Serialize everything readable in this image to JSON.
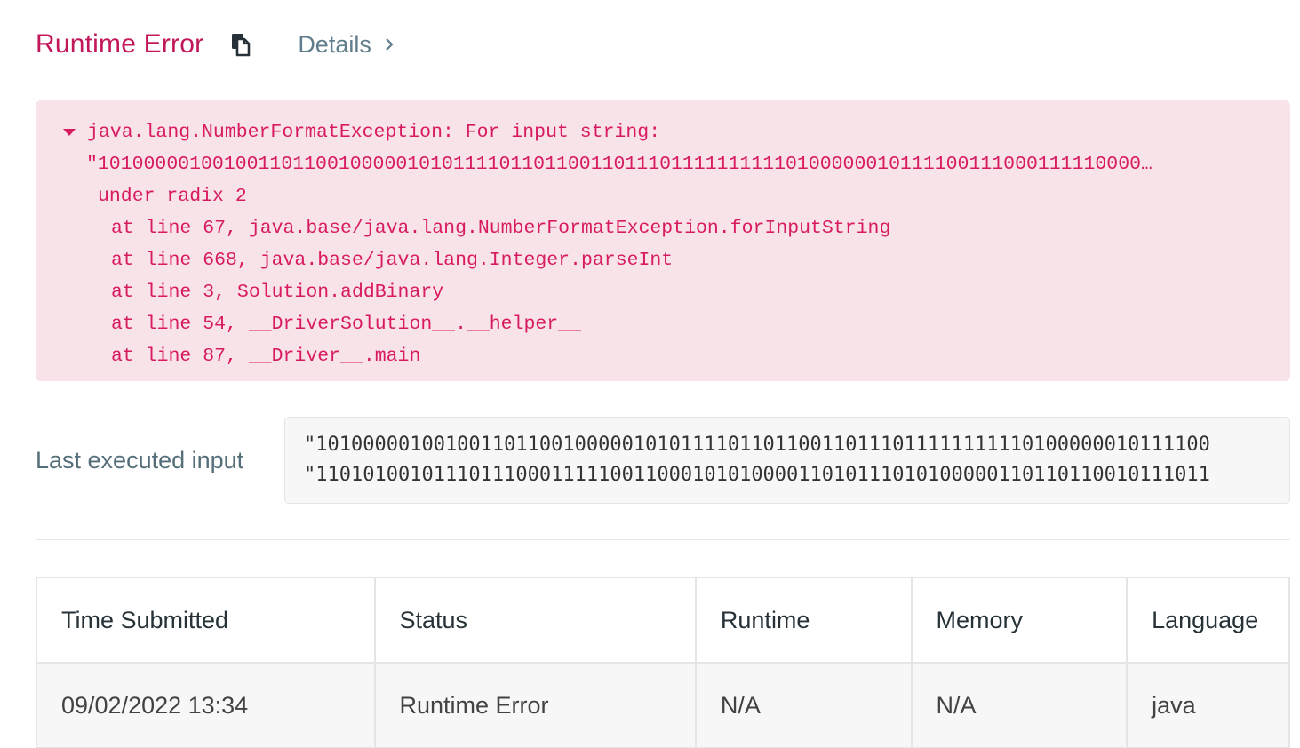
{
  "header": {
    "title": "Runtime Error",
    "details_label": "Details"
  },
  "error": {
    "lines": [
      "java.lang.NumberFormatException: For input string:",
      "\"1010000010010011011001000001010111101101100110111011111111110100000010111100111000111110000…",
      "under radix 2",
      "at line 67, java.base/java.lang.NumberFormatException.forInputString",
      "at line 668, java.base/java.lang.Integer.parseInt",
      "at line 3, Solution.addBinary",
      "at line 54, __DriverSolution__.__helper__",
      "at line 87, __Driver__.main"
    ]
  },
  "last_input": {
    "label": "Last executed input",
    "lines": [
      "\"1010000010010011011001000001010111101101100110111011111111110100000010111100",
      "\"1101010010111011100011111001100010101000011010111010100000110110110010111011"
    ]
  },
  "table": {
    "headers": [
      "Time Submitted",
      "Status",
      "Runtime",
      "Memory",
      "Language"
    ],
    "rows": [
      [
        "09/02/2022 13:34",
        "Runtime Error",
        "N/A",
        "N/A",
        "java"
      ]
    ]
  },
  "colors": {
    "accent": "#c2185b",
    "error_text": "#d81b60",
    "error_bg": "#f8e3e9",
    "status_error": "#c0392b"
  }
}
